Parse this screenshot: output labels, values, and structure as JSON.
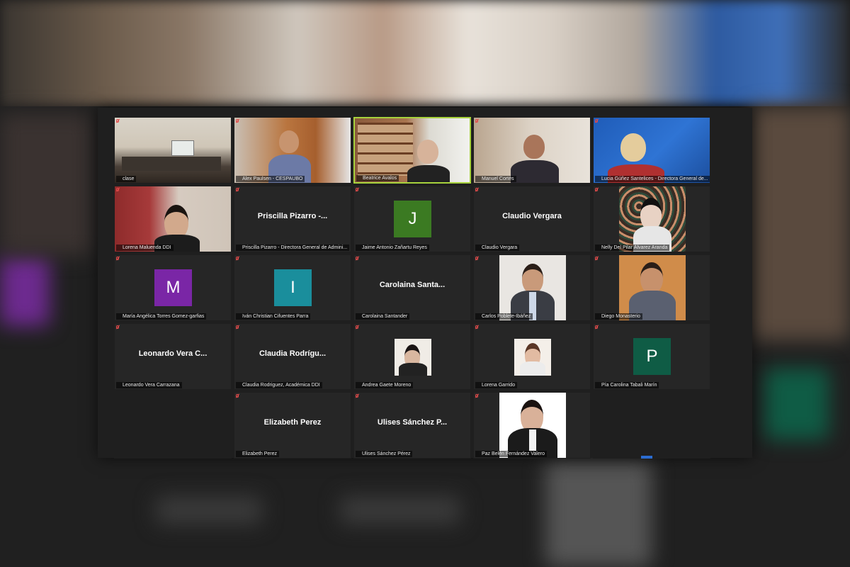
{
  "participants": [
    {
      "label": "clase"
    },
    {
      "label": "Alex Paulsen - CESPAUBO"
    },
    {
      "label": "Beatrice Avalos"
    },
    {
      "label": "Manuel Cortés"
    },
    {
      "label": "Lucia Gúñez Santelices - Directora General de..."
    },
    {
      "label": "Lorena Maluenda DDI"
    },
    {
      "label": "Priscilla Pizarro - Directora General de Admini...",
      "display": "Priscilla Pizarro -..."
    },
    {
      "label": "Jaime Antonio Zañartu Reyes",
      "initial": "J"
    },
    {
      "label": "Claudio Vergara",
      "display": "Claudio Vergara"
    },
    {
      "label": "Nelly Del Pilar Álvarez Aranda"
    },
    {
      "label": "María Angélica Torres Gomez-garfias",
      "initial": "M"
    },
    {
      "label": "Iván Christian Cifuentes Parra",
      "initial": "I"
    },
    {
      "label": "Carolaina Santander",
      "display": "Carolaina Santa..."
    },
    {
      "label": "Carlos Poblete-Ibáñez"
    },
    {
      "label": "Diego Monasterio"
    },
    {
      "label": "Leonardo Vera Carrazana",
      "display": "Leonardo Vera C..."
    },
    {
      "label": "Claudia Rodriguez, Académica DDI",
      "display": "Claudia Rodrígu..."
    },
    {
      "label": "Andrea Gaete Moreno"
    },
    {
      "label": "Lorena Garrido"
    },
    {
      "label": "Pía Carolina Tabali Marín",
      "initial": "P"
    },
    {
      "label": "Elizabeth Perez",
      "display": "Elizabeth Perez"
    },
    {
      "label": "Ulises Sánchez Pérez",
      "display": "Ulises Sánchez P..."
    },
    {
      "label": "Paz Belén Fernández Valero"
    }
  ],
  "colors": {
    "active_speaker_border": "#a7d23c",
    "avatar_j": "#3b7a22",
    "avatar_m": "#7a26a6",
    "avatar_i": "#1a8e9c",
    "avatar_p": "#0f5c45",
    "muted_icon": "#e24b4b"
  }
}
